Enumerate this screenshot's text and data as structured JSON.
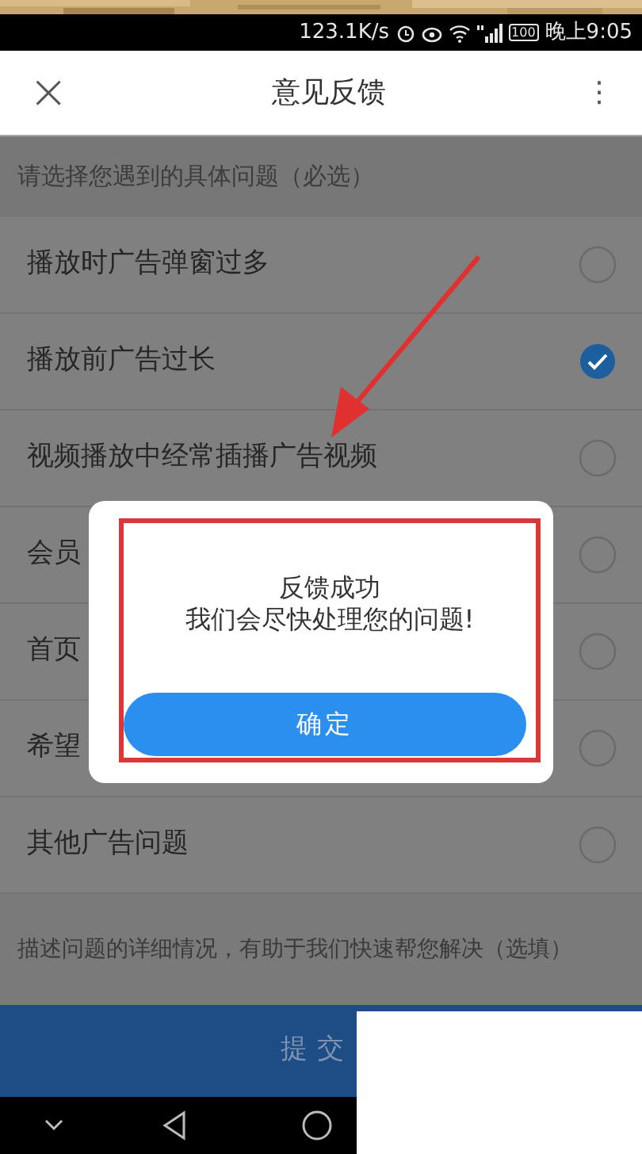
{
  "status_bar": {
    "speed": "123.1K/s",
    "battery": "100",
    "time": "晚上9:05"
  },
  "title_bar": {
    "close": "×",
    "title": "意见反馈",
    "menu": "⋮"
  },
  "prompt": "请选择您遇到的具体问题（必选）",
  "options": [
    {
      "label": "播放时广告弹窗过多",
      "selected": false
    },
    {
      "label": "播放前广告过长",
      "selected": true
    },
    {
      "label": "视频播放中经常插播广告视频",
      "selected": false
    },
    {
      "label": "会员",
      "selected": false
    },
    {
      "label": "首页",
      "selected": false
    },
    {
      "label": "希望",
      "selected": false
    },
    {
      "label": "其他广告问题",
      "selected": false
    }
  ],
  "details": {
    "placeholder": "描述问题的详细情况，有助于我们快速帮您解决（选填）"
  },
  "submit": "提交",
  "dialog": {
    "title": "反馈成功",
    "message": "我们会尽快处理您的问题!",
    "button": "确定"
  }
}
